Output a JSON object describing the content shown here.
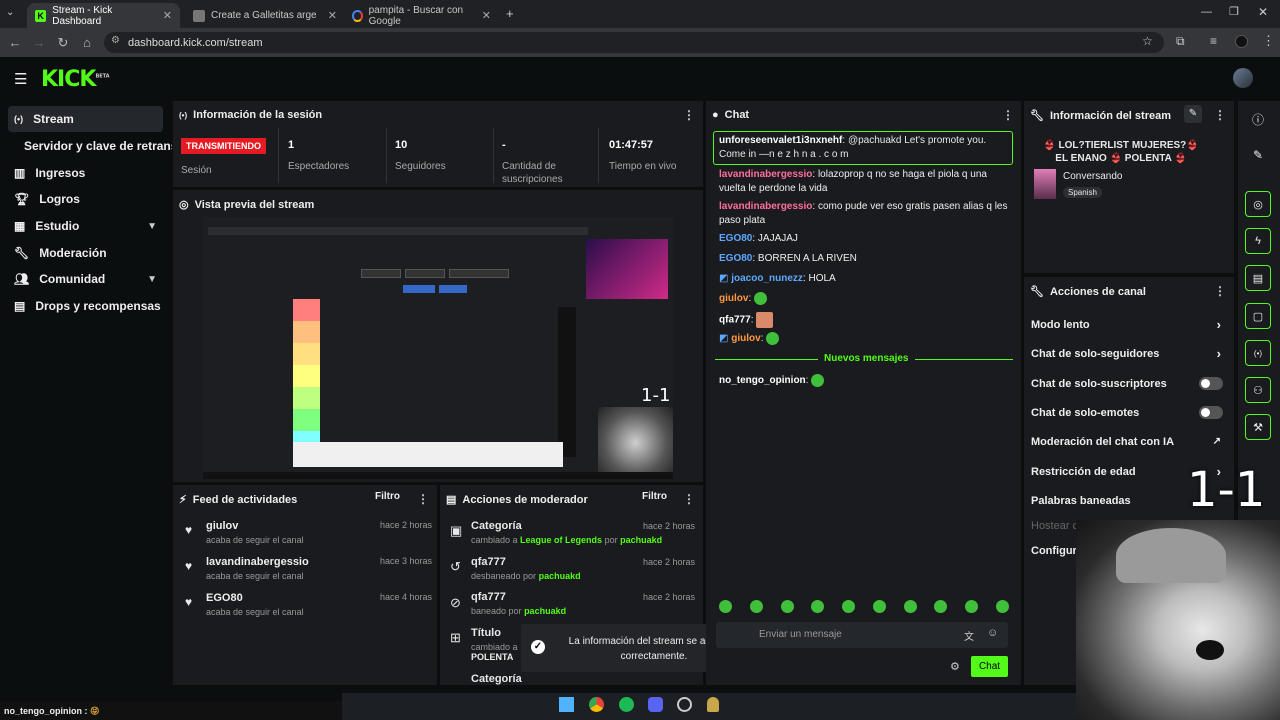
{
  "browser": {
    "tabs": [
      {
        "label": "Stream - Kick Dashboard",
        "active": true
      },
      {
        "label": "Create a Galletitas argentinas | "
      },
      {
        "label": "pampita - Buscar con Google"
      }
    ],
    "url": "dashboard.kick.com/stream"
  },
  "brand": {
    "logo": "KICK",
    "beta": "BETA",
    "accent": "#53fc18"
  },
  "sidebar": {
    "items": [
      {
        "label": "Stream"
      },
      {
        "label": "Servidor y clave de retransmisión"
      },
      {
        "label": "Ingresos"
      },
      {
        "label": "Logros"
      },
      {
        "label": "Estudio"
      },
      {
        "label": "Moderación"
      },
      {
        "label": "Comunidad"
      },
      {
        "label": "Drops y recompensas"
      }
    ]
  },
  "session": {
    "title": "Información de la sesión",
    "live_badge": "TRANSMITIENDO",
    "live_label": "Sesión",
    "stats": [
      {
        "value": "1",
        "label": "Espectadores"
      },
      {
        "value": "10",
        "label": "Seguidores"
      },
      {
        "value": "-",
        "label": "Cantidad de suscripciones"
      },
      {
        "value": "01:47:57",
        "label": "Tiempo en vivo"
      }
    ]
  },
  "preview": {
    "title": "Vista previa del stream",
    "score": "1-1"
  },
  "feed": {
    "title": "Feed de actividades",
    "filter": "Filtro",
    "rows": [
      {
        "name": "giulov",
        "sub": "acaba de seguir el canal",
        "time": "hace 2 horas"
      },
      {
        "name": "lavandinabergessio",
        "sub": "acaba de seguir el canal",
        "time": "hace 3 horas"
      },
      {
        "name": "EGO80",
        "sub": "acaba de seguir el canal",
        "time": "hace 4 horas"
      }
    ]
  },
  "modactions": {
    "title": "Acciones de moderador",
    "filter": "Filtro",
    "rows": [
      {
        "name": "Categoría",
        "pre": "cambiado a",
        "target": "League of Legends",
        "mid": "por",
        "by": "pachuakd",
        "time": "hace 2 horas"
      },
      {
        "name": "qfa777",
        "pre": "desbaneado por",
        "by": "pachuakd",
        "time": "hace 2 horas"
      },
      {
        "name": "qfa777",
        "pre": "baneado por",
        "by": "pachuakd",
        "time": "hace 2 horas"
      },
      {
        "name": "Título",
        "pre": "cambiado a",
        "target": "POLENTA"
      },
      {
        "name": "Categoría"
      }
    ]
  },
  "toast": {
    "text": "La información del stream se actualizó correctamente."
  },
  "chat": {
    "title": "Chat",
    "pinned": {
      "user": "unforeseenvalet1i3nxnehf",
      "text": "@pachuakd Let's promote you. Come in —n e z h n a . c o m"
    },
    "messages": [
      {
        "user": "lavandinabergessio",
        "text": "lolazoprop q no se haga el piola q una vuelta le perdone la vida"
      },
      {
        "user": "lavandinabergessio",
        "text": "como pude ver eso gratis pasen alias q les paso plata"
      },
      {
        "user": "EGO80",
        "text": "JAJAJAJ"
      },
      {
        "user": "EGO80",
        "text": "BORREN A LA RIVEN"
      },
      {
        "user": "joacoo_nunezz",
        "text": "HOLA"
      },
      {
        "user": "giulov",
        "text": ""
      },
      {
        "user": "qfa777",
        "text": ""
      },
      {
        "user": "giulov",
        "text": ""
      }
    ],
    "new_messages": "Nuevos mensajes",
    "after": {
      "user": "no_tengo_opinion",
      "text": ""
    },
    "input_placeholder": "Enviar un mensaje",
    "send": "Chat"
  },
  "streaminfo": {
    "title": "Información del stream",
    "stream_title": "👙 LOL?TIERLIST MUJERES?👙 EL ENANO 👙 POLENTA 👙",
    "category": "Conversando",
    "language": "Spanish"
  },
  "channel": {
    "title": "Acciones de canal",
    "rows": [
      {
        "label": "Modo lento"
      },
      {
        "label": "Chat de solo-seguidores"
      },
      {
        "label": "Chat de solo-suscriptores"
      },
      {
        "label": "Chat de solo-emotes"
      },
      {
        "label": "Moderación del chat con IA"
      },
      {
        "label": "Restricción de edad"
      },
      {
        "label": "Palabras baneadas"
      },
      {
        "label": "Hostear canal"
      },
      {
        "label": "Configuración"
      }
    ]
  },
  "overlay": {
    "score": "1-1"
  },
  "statusbar": {
    "text": "no_tengo_opinion :"
  }
}
